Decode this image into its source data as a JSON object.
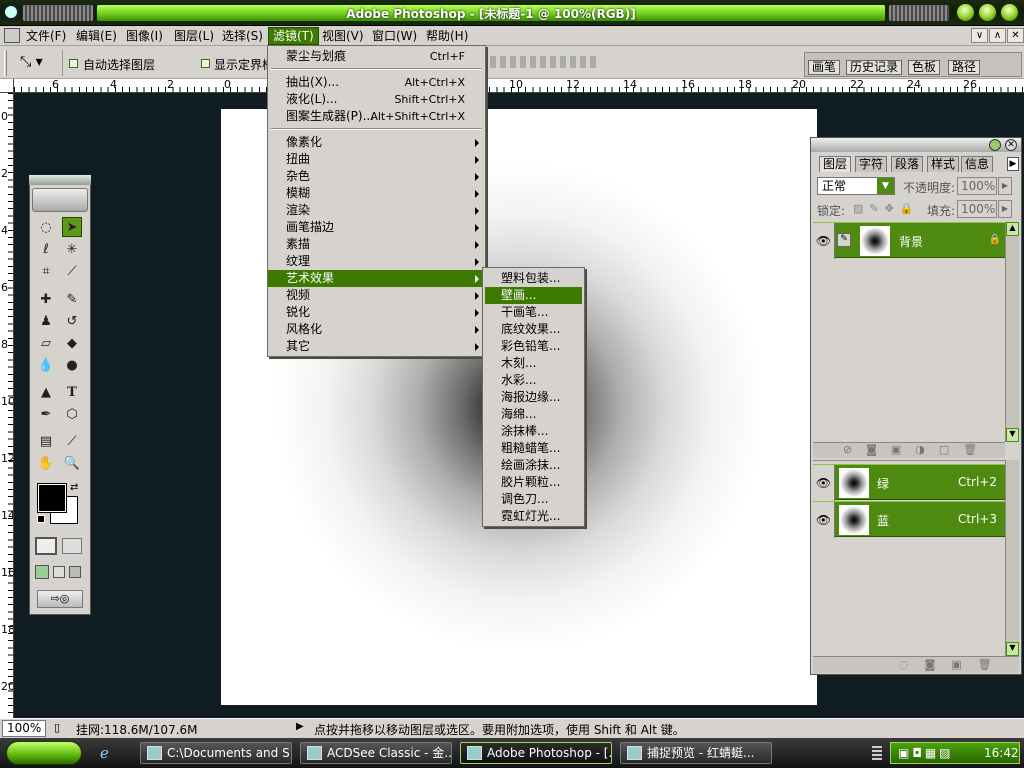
{
  "window": {
    "title": "Adobe Photoshop - [未标题-1 @ 100%(RGB)]"
  },
  "menubar": {
    "items": [
      "文件(F)",
      "编辑(E)",
      "图像(I)",
      "图层(L)",
      "选择(S)",
      "滤镜(T)",
      "视图(V)",
      "窗口(W)",
      "帮助(H)"
    ],
    "active": "滤镜(T)"
  },
  "options_bar": {
    "auto_select_layer": "自动选择图层",
    "show_bounding_box": "显示定界框"
  },
  "dock_tabs": [
    "画笔",
    "历史记录",
    "色板",
    "路径"
  ],
  "rulers": {
    "horizontal": [
      "6",
      "4",
      "2",
      "0",
      "2",
      "4",
      "6",
      "8",
      "10",
      "12",
      "14",
      "16",
      "18",
      "20",
      "22",
      "24",
      "26"
    ],
    "vertical": [
      "0",
      "2",
      "4",
      "6",
      "8",
      "10",
      "12",
      "14",
      "16",
      "18",
      "20"
    ]
  },
  "filter_menu": {
    "items": [
      {
        "label": "蒙尘与划痕",
        "shortcut": "Ctrl+F"
      },
      {
        "label": "抽出(X)...",
        "shortcut": "Alt+Ctrl+X"
      },
      {
        "label": "液化(L)...",
        "shortcut": "Shift+Ctrl+X"
      },
      {
        "label": "图案生成器(P)...",
        "shortcut": "Alt+Shift+Ctrl+X"
      },
      {
        "label": "像素化"
      },
      {
        "label": "扭曲"
      },
      {
        "label": "杂色"
      },
      {
        "label": "模糊"
      },
      {
        "label": "渲染"
      },
      {
        "label": "画笔描边"
      },
      {
        "label": "素描"
      },
      {
        "label": "纹理"
      },
      {
        "label": "艺术效果"
      },
      {
        "label": "视频"
      },
      {
        "label": "锐化"
      },
      {
        "label": "风格化"
      },
      {
        "label": "其它"
      }
    ],
    "highlighted": "艺术效果"
  },
  "artistic_submenu": {
    "items": [
      "塑料包装...",
      "壁画...",
      "干画笔...",
      "底纹效果...",
      "彩色铅笔...",
      "木刻...",
      "水彩...",
      "海报边缘...",
      "海绵...",
      "涂抹棒...",
      "粗糙蜡笔...",
      "绘画涂抹...",
      "胶片颗粒...",
      "调色刀...",
      "霓虹灯光..."
    ],
    "highlighted": "壁画..."
  },
  "layers_panel": {
    "tabs": [
      "图层",
      "字符",
      "段落",
      "样式",
      "信息"
    ],
    "blend_mode": "正常",
    "opacity_label": "不透明度:",
    "opacity": "100%",
    "lock_label": "锁定:",
    "fill_label": "填充:",
    "fill": "100%",
    "layers": [
      {
        "name": "背景"
      }
    ],
    "channels": [
      {
        "name": "绿",
        "shortcut": "Ctrl+2"
      },
      {
        "name": "蓝",
        "shortcut": "Ctrl+3"
      }
    ]
  },
  "status": {
    "zoom": "100%",
    "memory": "挂网:118.6M/107.6M",
    "hint": "点按并拖移以移动图层或选区。要用附加选项，使用 Shift 和 Alt 键。"
  },
  "taskbar": {
    "tasks": [
      "C:\\Documents and S...",
      "ACDSee Classic - 金...",
      "Adobe Photoshop - [...",
      "捕捉预览 - 红蜻蜓..."
    ],
    "active": "Adobe Photoshop - [...",
    "clock": "16:42"
  },
  "colors": {
    "accent": "#3d7a00",
    "title_green": "#6fcf19",
    "ui_gray": "#d6d3ce",
    "desktop": "#0f1c21"
  }
}
